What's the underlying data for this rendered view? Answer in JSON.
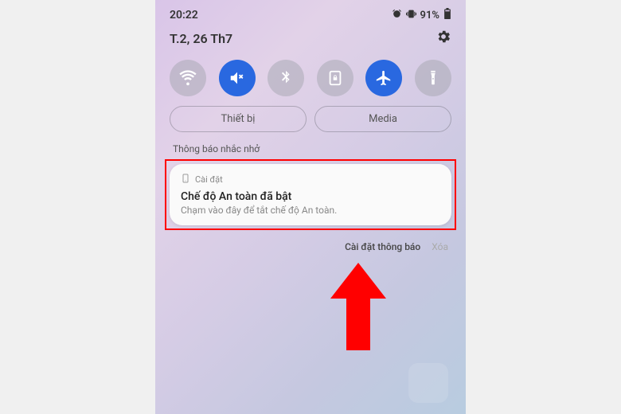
{
  "status": {
    "time": "20:22",
    "battery_pct": "91%"
  },
  "date": "T.2, 26 Th7",
  "quick_settings": {
    "wifi": {
      "on": false
    },
    "mute": {
      "on": true
    },
    "bluetooth": {
      "on": false
    },
    "lock": {
      "on": false
    },
    "airplane": {
      "on": true
    },
    "flashlight": {
      "on": false
    }
  },
  "pills": {
    "devices": "Thiết bị",
    "media": "Media"
  },
  "section_label": "Thông báo nhắc nhở",
  "notification": {
    "app_name": "Cài đặt",
    "title": "Chế độ An toàn đã bật",
    "body": "Chạm vào đây để tắt chế độ An toàn."
  },
  "footer": {
    "settings": "Cài đặt thông báo",
    "clear": "Xóa"
  }
}
